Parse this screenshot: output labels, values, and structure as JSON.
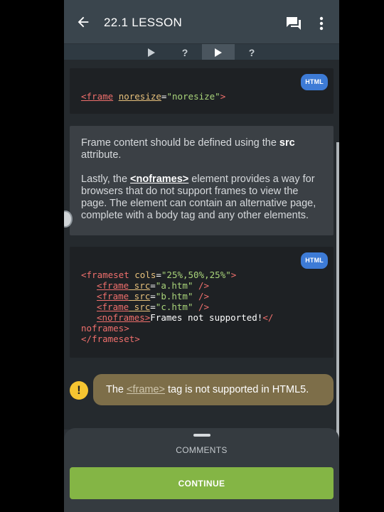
{
  "appbar": {
    "title": "22.1 LESSON"
  },
  "tabs": [
    {
      "type": "play",
      "label": "",
      "active": false
    },
    {
      "type": "question",
      "label": "?",
      "active": false
    },
    {
      "type": "play",
      "label": "",
      "active": true
    },
    {
      "type": "question",
      "label": "?",
      "active": false
    }
  ],
  "code1": {
    "badge": "HTML",
    "tag": "<frame",
    "attr": "noresize",
    "eq": "=",
    "value": "\"noresize\"",
    "close": ">"
  },
  "text_card": {
    "p1_before": "Frame content should be defined using the ",
    "p1_bold": "src",
    "p1_after": " attribute.",
    "p2_before": "Lastly, the ",
    "p2_link": "<noframes>",
    "p2_after": " element provides a way for browsers that do not support frames to view the page. The element can contain an alternative page, complete with a body tag and any other elements."
  },
  "code2": {
    "badge": "HTML",
    "l1_tag": "<frameset",
    "l1_attr": " cols",
    "l1_eq": "=",
    "l1_val": "\"25%,50%,25%\"",
    "l1_close": ">",
    "frames": [
      {
        "tag": "<frame",
        "attr": " src",
        "eq": "=",
        "val": "\"a.htm\"",
        "close": " />"
      },
      {
        "tag": "<frame",
        "attr": " src",
        "eq": "=",
        "val": "\"b.htm\"",
        "close": " />"
      },
      {
        "tag": "<frame",
        "attr": " src",
        "eq": "=",
        "val": "\"c.htm\"",
        "close": " />"
      }
    ],
    "nf_open": "<noframes>",
    "nf_text": "Frames not supported!",
    "nf_close1": "</",
    "nf_close2": "noframes>",
    "end": "</frameset>"
  },
  "note": {
    "before": "The",
    "link": "<frame>",
    "after": "tag is not supported in HTML5.",
    "icon": "!"
  },
  "bottom": {
    "comments": "COMMENTS",
    "continue": "CONTINUE"
  }
}
